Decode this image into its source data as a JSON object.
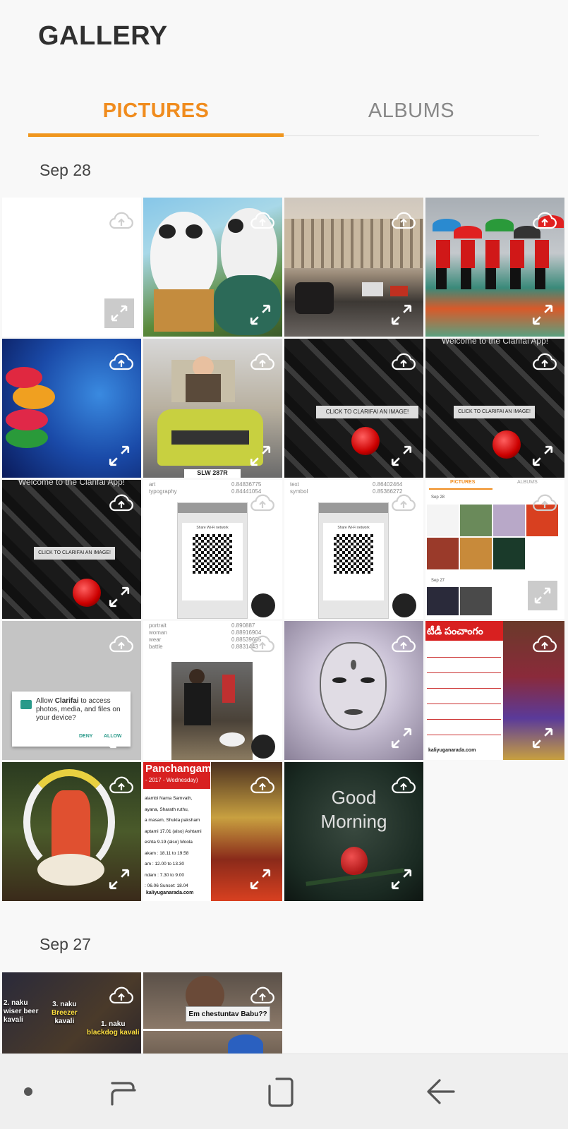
{
  "app": {
    "title": "GALLERY"
  },
  "tabs": [
    {
      "label": "PICTURES",
      "active": true
    },
    {
      "label": "ALBUMS",
      "active": false
    }
  ],
  "sections": [
    {
      "date": "Sep 28"
    },
    {
      "date": "Sep 27"
    }
  ],
  "tiles_text": {
    "clarifai_btn": "CLICK TO CLARIFAI AN IMAGE!",
    "welcome": "Welcome to the Clarifai App!",
    "wifi_title": "Share Wi-Fi network",
    "tags_a": [
      "art",
      "typography"
    ],
    "vals_a": [
      "0.84836775",
      "0.84441054"
    ],
    "tags_b": [
      "text",
      "symbol"
    ],
    "vals_b": [
      "0.86402464",
      "0.85366272"
    ],
    "tags_c": [
      "portrait",
      "woman",
      "wear",
      "battle"
    ],
    "vals_c": [
      "0.890887",
      "0.88916904",
      "0.88539605",
      "0.8831443"
    ],
    "dialog_text_pre": "Allow ",
    "dialog_text_app": "Clarifai",
    "dialog_text_post": " to access photos, media, and files on your device?",
    "dialog_deny": "DENY",
    "dialog_allow": "ALLOW",
    "panchangam_title": "Panchangam",
    "panchangam_sub": "- 2017 - Wednesday)",
    "panchangam_lines": [
      "alambi Nama Samvath,",
      "ayana, Sharath ruthu,",
      "a masam, Shukla paksham",
      "aptami 17.01 (also) Ashtami",
      "eshta 9.19 (also) Moola",
      "akam : 18.11 to 19.58",
      "am : 12.00 to 13.30",
      "ndam : 7.30 to 9.00",
      ": 06.06    Sunset: 18.04"
    ],
    "panchangam_url": "kaliyuganarada.com",
    "telugu_title": "టీడీ పంచాంగం",
    "telugu_url": "kaliyuganarada.com",
    "good_morning_1": "Good",
    "good_morning_2": "Morning",
    "mini_tab_pictures": "PICTURES",
    "mini_tab_albums": "ALBUMS",
    "mini_date_1": "Sep 28",
    "mini_date_2": "Sep 27",
    "beer_1": "2. naku",
    "beer_2": "wiser beer",
    "beer_3": "kavali",
    "beer_4": "3. naku",
    "beer_5": "Breezer",
    "beer_6": "kavali",
    "beer_7": "1. naku",
    "beer_8": "blackdog kavali",
    "babu": "Em chestuntav Babu??",
    "car_plate": "SLW 287R"
  },
  "colors": {
    "accent": "#f08c1e",
    "title": "#303030"
  }
}
